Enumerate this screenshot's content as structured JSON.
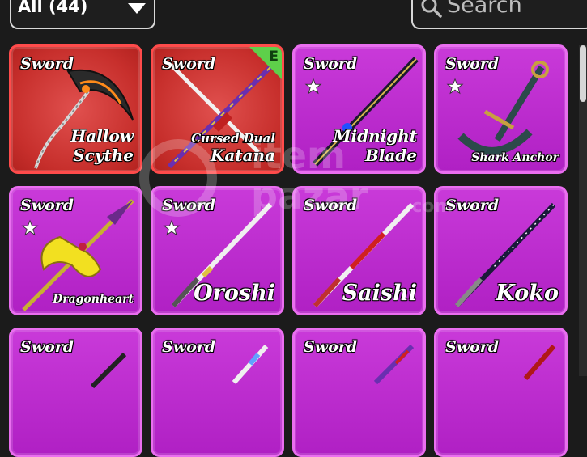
{
  "filter": {
    "label": "All (44)"
  },
  "search": {
    "placeholder": "Search"
  },
  "colors": {
    "epic_bg": "#b020c4",
    "epic_border": "#ea6ef0",
    "red_bg": "#c72f2c",
    "red_border": "#ff4b4b",
    "badge": "#5ed04a"
  },
  "watermark": {
    "line1": "item",
    "line2": "pazar",
    "suffix": ".com"
  },
  "items": [
    {
      "type": "Sword",
      "name": "Hallow Scythe",
      "line1": "Hallow",
      "line2": "Scythe",
      "style": "red",
      "star": false,
      "badge": ""
    },
    {
      "type": "Sword",
      "name": "Cursed Dual Katana",
      "line1": "Cursed Dual",
      "line2": "Katana",
      "style": "red",
      "star": false,
      "badge": "E"
    },
    {
      "type": "Sword",
      "name": "Midnight Blade",
      "line1": "Midnight",
      "line2": "Blade",
      "style": "epic",
      "star": true,
      "badge": ""
    },
    {
      "type": "Sword",
      "name": "Shark Anchor",
      "line1": "",
      "line2": "Shark Anchor",
      "style": "epic",
      "star": true,
      "badge": ""
    },
    {
      "type": "Sword",
      "name": "Dragonheart",
      "line1": "",
      "line2": "Dragonheart",
      "style": "epic",
      "star": true,
      "badge": ""
    },
    {
      "type": "Sword",
      "name": "Oroshi",
      "line1": "",
      "line2": "Oroshi",
      "style": "epic",
      "star": true,
      "badge": ""
    },
    {
      "type": "Sword",
      "name": "Saishi",
      "line1": "",
      "line2": "Saishi",
      "style": "epic",
      "star": false,
      "badge": ""
    },
    {
      "type": "Sword",
      "name": "Koko",
      "line1": "",
      "line2": "Koko",
      "style": "epic",
      "star": false,
      "badge": ""
    },
    {
      "type": "Sword",
      "name": "",
      "line1": "",
      "line2": "",
      "style": "epic",
      "star": false,
      "badge": ""
    },
    {
      "type": "Sword",
      "name": "",
      "line1": "",
      "line2": "",
      "style": "epic",
      "star": false,
      "badge": ""
    },
    {
      "type": "Sword",
      "name": "",
      "line1": "",
      "line2": "",
      "style": "epic",
      "star": false,
      "badge": ""
    },
    {
      "type": "Sword",
      "name": "",
      "line1": "",
      "line2": "",
      "style": "epic",
      "star": false,
      "badge": ""
    }
  ]
}
